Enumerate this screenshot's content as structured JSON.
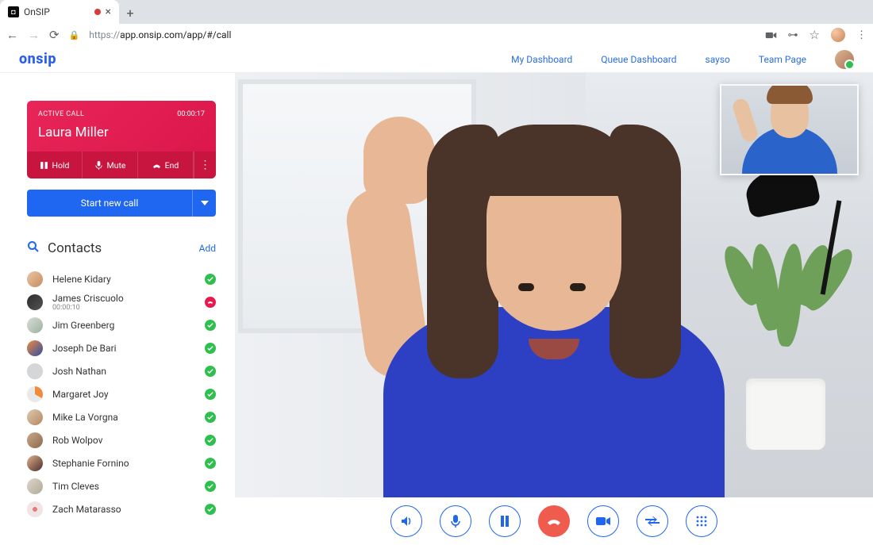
{
  "browser": {
    "tab_title": "OnSIP",
    "url_proto": "https://",
    "url_rest": "app.onsip.com/app/#/call"
  },
  "header": {
    "logo": "onsip",
    "links": [
      "My Dashboard",
      "Queue Dashboard",
      "sayso",
      "Team Page"
    ]
  },
  "active_call": {
    "label": "ACTIVE CALL",
    "timer": "00:00:17",
    "name": "Laura Miller",
    "hold": "Hold",
    "mute": "Mute",
    "end": "End"
  },
  "start_call": "Start new call",
  "contacts": {
    "title": "Contacts",
    "add": "Add",
    "items": [
      {
        "name": "Helene Kidary",
        "status": "avail",
        "avatar": "av1"
      },
      {
        "name": "James Criscuolo",
        "sub": "00:00:10",
        "status": "busy",
        "avatar": "av2"
      },
      {
        "name": "Jim Greenberg",
        "status": "avail",
        "avatar": "av3"
      },
      {
        "name": "Joseph De Bari",
        "status": "avail",
        "avatar": "av4"
      },
      {
        "name": "Josh Nathan",
        "status": "avail",
        "avatar": "av5"
      },
      {
        "name": "Margaret Joy",
        "status": "avail",
        "avatar": "av6"
      },
      {
        "name": "Mike La Vorgna",
        "status": "avail",
        "avatar": "av7"
      },
      {
        "name": "Rob Wolpov",
        "status": "avail",
        "avatar": "av8"
      },
      {
        "name": "Stephanie Fornino",
        "status": "avail",
        "avatar": "av9"
      },
      {
        "name": "Tim Cleves",
        "status": "avail",
        "avatar": "av10"
      },
      {
        "name": "Zach Matarasso",
        "status": "avail",
        "avatar": "av11"
      }
    ]
  },
  "call_controls": [
    "speaker",
    "mic",
    "pause",
    "hangup",
    "video",
    "transfer",
    "dialpad"
  ]
}
